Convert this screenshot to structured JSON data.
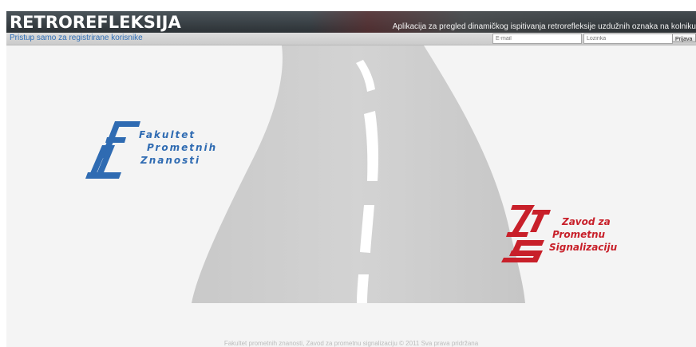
{
  "header": {
    "brand": "RETROREFLEKSIJA",
    "tagline": "Aplikacija za pregled dinamičkog ispitivanja retrorefleksije uzdužnih oznaka na kolniku"
  },
  "subbar": {
    "note": "Pristup samo za registrirane korisnike",
    "email_placeholder": "E-mail",
    "password_placeholder": "Lozinka",
    "login_label": "Prijava"
  },
  "logos": {
    "fpz": {
      "lines": [
        "Fakultet",
        "Prometnih",
        "Znanosti"
      ],
      "color": "#2f6bb2",
      "icon": "fpz-logo-icon"
    },
    "zps": {
      "lines": [
        "Zavod za",
        "Prometnu",
        "Signalizaciju"
      ],
      "color": "#c8202a",
      "icon": "zps-logo-icon"
    }
  },
  "footer": {
    "text": "Fakultet prometnih znanosti, Zavod za prometnu signalizaciju © 2011 Sva prava pridržana"
  },
  "colors": {
    "header_dark": "#2c3236",
    "link_blue": "#2e6db5",
    "road_gray": "#cfcfcf",
    "background": "#f4f4f4"
  }
}
